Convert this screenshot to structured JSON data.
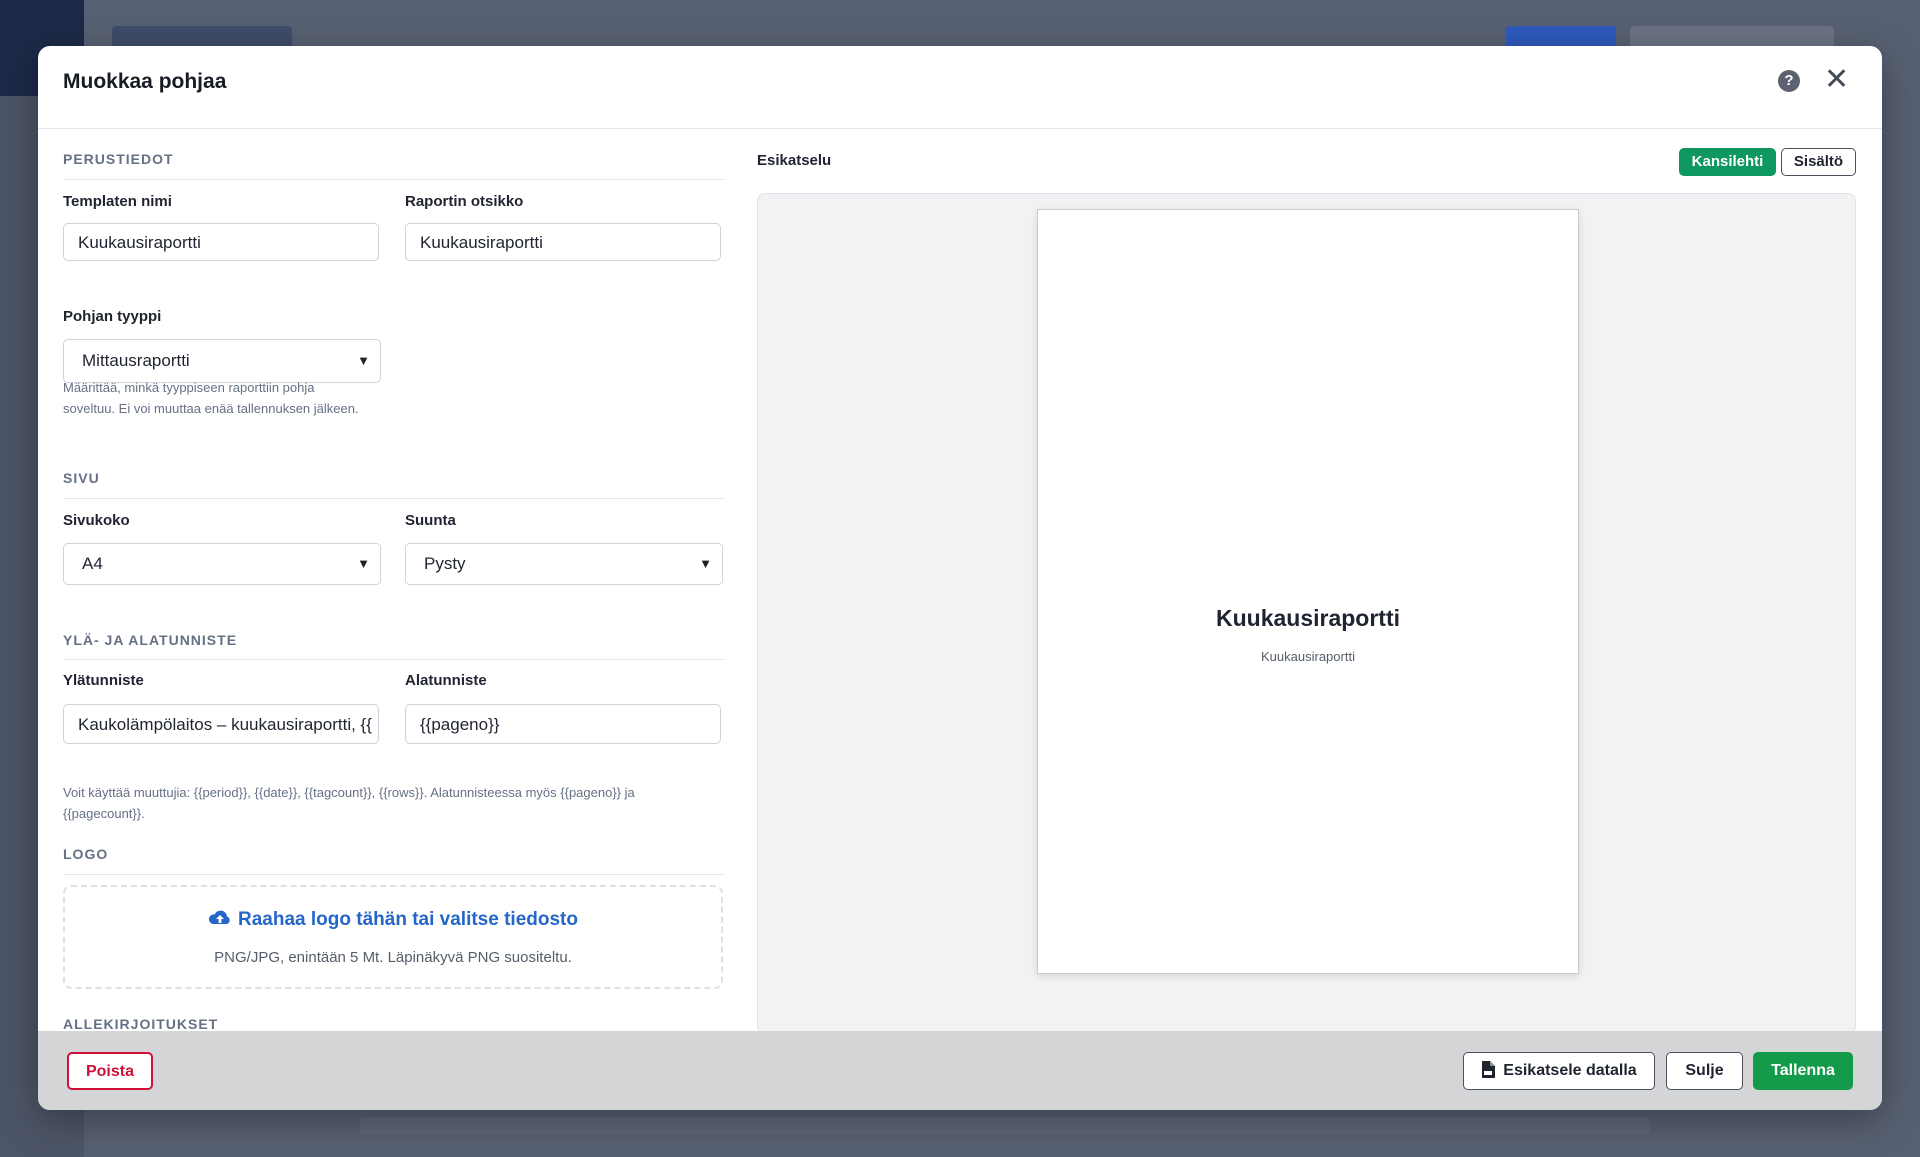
{
  "modal": {
    "title": "Muokkaa pohjaa"
  },
  "basic": {
    "section_title": "PERUSTIEDOT",
    "template_name_label": "Templaten nimi",
    "template_name_value": "Kuukausiraportti",
    "report_title_label": "Raportin otsikko",
    "report_title_value": "Kuukausiraportti",
    "type_label": "Pohjan tyyppi",
    "type_value": "Mittausraportti",
    "type_help_line1": "Määrittää, minkä tyyppiseen raporttiin pohja",
    "type_help_line2": "soveltuu. Ei voi muuttaa enää tallennuksen jälkeen."
  },
  "page": {
    "section_title": "SIVU",
    "size_label": "Sivukoko",
    "size_value": "A4",
    "orientation_label": "Suunta",
    "orientation_value": "Pysty"
  },
  "header_footer": {
    "section_title": "YLÄ- JA ALATUNNISTE",
    "header_label": "Ylätunniste",
    "header_value": "Kaukolämpölaitos – kuukausiraportti, {{",
    "footer_label": "Alatunniste",
    "footer_value": "{{pageno}}",
    "help_line1": "Voit käyttää muuttujia: {{period}}, {{date}}, {{tagcount}}, {{rows}}. Alatunnisteessa myös {{pageno}} ja",
    "help_line2": "{{pagecount}}."
  },
  "logo": {
    "section_title": "LOGO",
    "drop_link": "Raahaa logo tähän tai valitse tiedosto",
    "drop_note": "PNG/JPG, enintään 5 Mt. Läpinäkyvä PNG suositeltu."
  },
  "signatures": {
    "section_title": "ALLEKIRJOITUKSET"
  },
  "preview": {
    "label": "Esikatselu",
    "tab_cover": "Kansilehti",
    "tab_content": "Sisältö",
    "page_title": "Kuukausiraportti",
    "page_subtitle": "Kuukausiraportti"
  },
  "footer": {
    "delete": "Poista",
    "preview_data": "Esikatsele datalla",
    "close": "Sulje",
    "save": "Tallenna"
  },
  "colors": {
    "accent_green": "#0f9760",
    "save_green": "#149a4b",
    "danger_red": "#d0103a",
    "link_blue": "#2566c9"
  }
}
